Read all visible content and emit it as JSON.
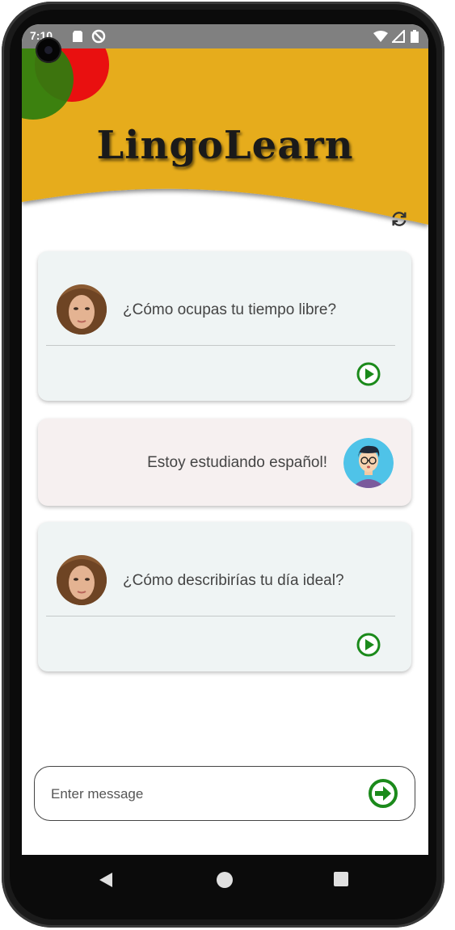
{
  "status_bar": {
    "time": "7:10"
  },
  "app": {
    "title": "LingoLearn"
  },
  "colors": {
    "header": "#E6AC1A",
    "accent_green": "#1B8A1B",
    "circle_red": "#E91010",
    "circle_green": "#2E7D0E"
  },
  "messages": [
    {
      "role": "bot",
      "text": "¿Cómo ocupas tu tiempo libre?"
    },
    {
      "role": "user",
      "text": "Estoy estudiando español!"
    },
    {
      "role": "bot",
      "text": "¿Cómo describirías tu día ideal?"
    }
  ],
  "composer": {
    "placeholder": "Enter message"
  },
  "icons": {
    "refresh": "refresh-icon",
    "play": "play-icon",
    "send": "send-arrow-icon",
    "back": "back-icon",
    "home": "home-icon",
    "recents": "recents-icon"
  }
}
